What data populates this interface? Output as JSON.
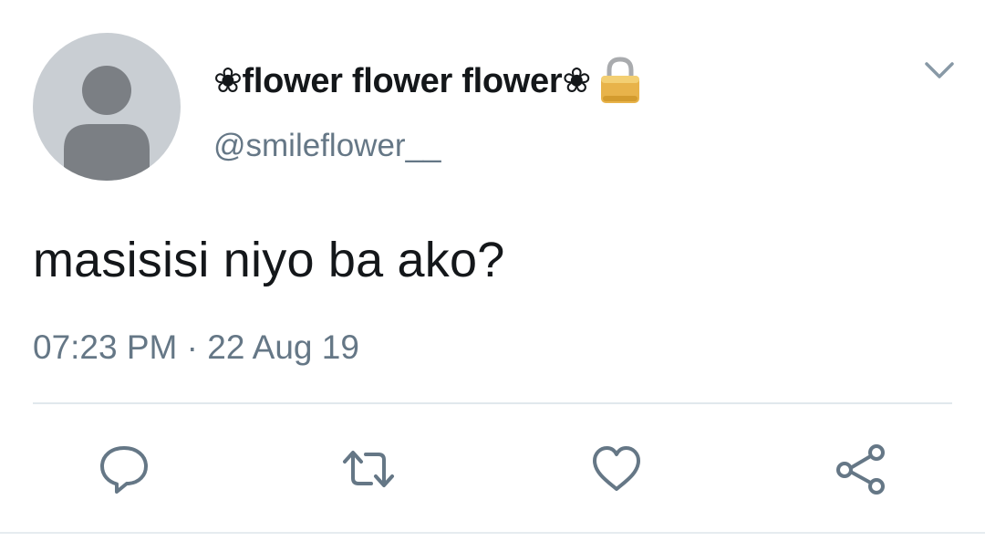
{
  "tweet": {
    "display_name": "❀flower flower flower❀",
    "handle": "@smileflower__",
    "text": "masisisi niyo ba ako?",
    "time": "07:23 PM",
    "separator": "·",
    "date": "22 Aug 19",
    "protected": true
  },
  "icons": {
    "avatar": "default-avatar-icon",
    "lock": "lock-icon",
    "menu": "chevron-down-icon",
    "reply": "reply-icon",
    "retweet": "retweet-icon",
    "like": "heart-icon",
    "share": "share-icon"
  },
  "colors": {
    "text_primary": "#14171a",
    "text_secondary": "#657786",
    "icon": "#657786",
    "avatar_bg": "#c9ced3",
    "avatar_fg": "#7b7f84",
    "divider": "#e1e8ed",
    "lock_body": "#e8b34a"
  }
}
